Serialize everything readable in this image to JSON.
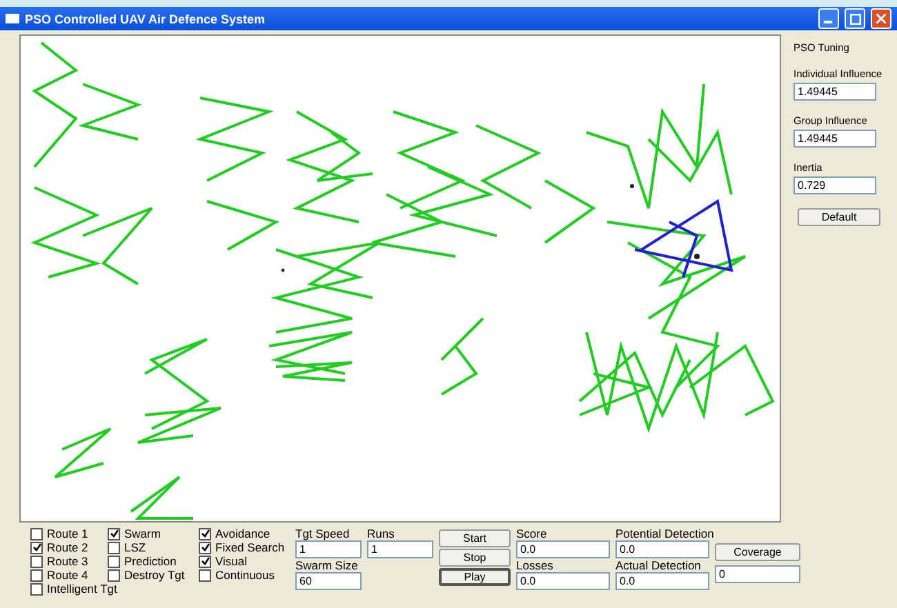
{
  "window": {
    "title": "PSO Controlled UAV Air Defence System"
  },
  "tuning": {
    "title": "PSO Tuning",
    "fields": [
      {
        "label": "Individual Influence",
        "value": "1.49445"
      },
      {
        "label": "Group Influence",
        "value": "1.49445"
      },
      {
        "label": "Inertia",
        "value": "0.729"
      }
    ],
    "button": "Default"
  },
  "options": [
    [
      {
        "label": "Route 1",
        "checked": false
      },
      {
        "label": "Route 2",
        "checked": true
      },
      {
        "label": "Route 3",
        "checked": false
      },
      {
        "label": "Route 4",
        "checked": false
      },
      {
        "label": "Intelligent Tgt",
        "checked": false
      }
    ],
    [
      {
        "label": "Swarm",
        "checked": true
      },
      {
        "label": "LSZ",
        "checked": false
      },
      {
        "label": "Prediction",
        "checked": false
      },
      {
        "label": "Destroy Tgt",
        "checked": false
      }
    ],
    [
      {
        "label": "Avoidance",
        "checked": true
      },
      {
        "label": "Fixed Search",
        "checked": true
      },
      {
        "label": "Visual",
        "checked": true
      },
      {
        "label": "Continuous",
        "checked": false
      }
    ]
  ],
  "settings": [
    [
      {
        "label": "Tgt Speed",
        "value": "1"
      },
      {
        "label": "Swarm Size",
        "value": "60"
      }
    ],
    [
      {
        "label": "Runs",
        "value": "1"
      }
    ]
  ],
  "buttons": [
    "Start",
    "Stop",
    "Play"
  ],
  "results": [
    [
      {
        "label": "Score",
        "value": "0.0"
      },
      {
        "label": "Losses",
        "value": "0.0"
      }
    ],
    [
      {
        "label": "Potential Detection",
        "value": "0.0"
      },
      {
        "label": "Actual Detection",
        "value": "0.0"
      }
    ]
  ],
  "coverage": {
    "button": "Coverage",
    "value": "0"
  }
}
